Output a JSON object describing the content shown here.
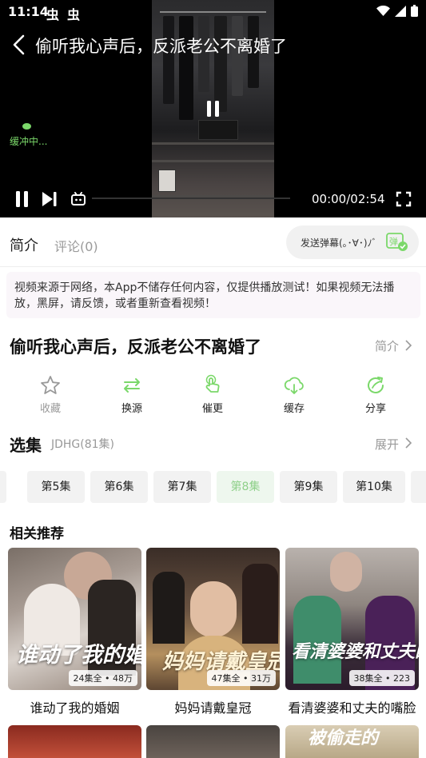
{
  "status_bar": {
    "time": "11:14",
    "notif_icons": [
      "bug-icon",
      "bug-icon"
    ]
  },
  "player": {
    "title": "偷听我心声后，反派老公不离婚了",
    "buffering_text": "缓冲中...",
    "time_readout": "00:00/02:54",
    "progress": 0
  },
  "tabs": {
    "intro": "简介",
    "comments": "评论(0)"
  },
  "danmaku": {
    "placeholder": "发送弹幕(｡･∀･)ﾉﾞ",
    "icon_text": "弹"
  },
  "notice": "视频来源于网络，本App不储存任何内容，仅提供播放测试！如果视频无法播放，黑屏，请反馈，或者重新查看视频！",
  "drama": {
    "title": "偷听我心声后，反派老公不离婚了",
    "intro_link": "简介"
  },
  "actions": [
    {
      "label": "收藏",
      "icon": "star-icon",
      "color": "#999999"
    },
    {
      "label": "换源",
      "icon": "swap-icon",
      "color": "#222222"
    },
    {
      "label": "催更",
      "icon": "urge-icon",
      "color": "#222222"
    },
    {
      "label": "缓存",
      "icon": "download-icon",
      "color": "#222222"
    },
    {
      "label": "分享",
      "icon": "share-icon",
      "color": "#222222"
    }
  ],
  "accent_color": "#7bd86a",
  "episodes": {
    "title": "选集",
    "source": "JDHG(81集)",
    "expand": "展开",
    "items": [
      "第5集",
      "第6集",
      "第7集",
      "第8集",
      "第9集",
      "第10集"
    ],
    "active": "第8集"
  },
  "recommendations": {
    "title": "相关推荐",
    "items": [
      {
        "name": "谁动了我的婚姻",
        "badge": "24集全 • 48万",
        "poster_text": "谁动了我的婚姻"
      },
      {
        "name": "妈妈请戴皇冠",
        "badge": "47集全 • 31万",
        "poster_text": "妈妈请戴皇冠"
      },
      {
        "name": "看清婆婆和丈夫的嘴脸",
        "badge": "38集全 • 223",
        "poster_text": "看清婆婆和丈夫的嘴脸"
      }
    ],
    "second_row_text": "被偷走的"
  }
}
